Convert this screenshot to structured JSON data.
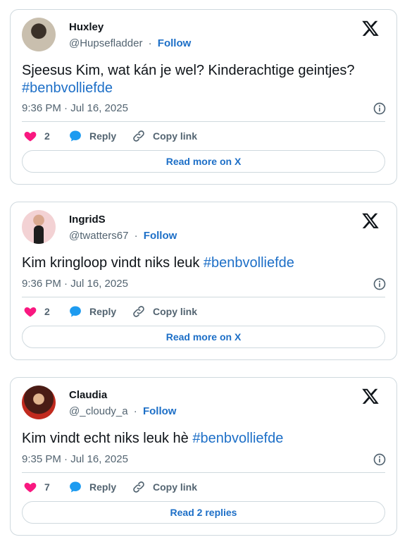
{
  "colors": {
    "link": "#1d6fc7",
    "like": "#f91880",
    "reply": "#1d9bf0",
    "border": "#cfd9de",
    "muted": "#536471"
  },
  "tweets": [
    {
      "name": "Huxley",
      "handle": "@Hupsefladder",
      "separator": "·",
      "follow": "Follow",
      "text": "Sjeesus Kim, wat kán je wel? Kinderachtige geintjes?",
      "hashtag": "#benbvolliefde",
      "timestamp": "9:36 PM · Jul 16, 2025",
      "likes": "2",
      "reply_label": "Reply",
      "copy_label": "Copy link",
      "cta": "Read more on X"
    },
    {
      "name": "IngridS",
      "handle": "@twatters67",
      "separator": "·",
      "follow": "Follow",
      "text": "Kim kringloop vindt niks leuk ",
      "hashtag": "#benbvolliefde",
      "timestamp": "9:36 PM · Jul 16, 2025",
      "likes": "2",
      "reply_label": "Reply",
      "copy_label": "Copy link",
      "cta": "Read more on X"
    },
    {
      "name": "Claudia",
      "handle": "@_cloudy_a",
      "separator": "·",
      "follow": "Follow",
      "text": "Kim vindt echt niks leuk hè ",
      "hashtag": "#benbvolliefde",
      "timestamp": "9:35 PM · Jul 16, 2025",
      "likes": "7",
      "reply_label": "Reply",
      "copy_label": "Copy link",
      "cta": "Read 2 replies"
    }
  ]
}
